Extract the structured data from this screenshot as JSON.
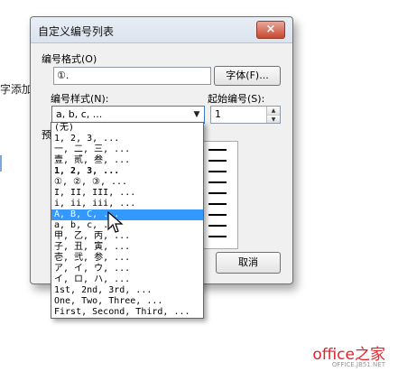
{
  "background": {
    "text": "字添加"
  },
  "dialog": {
    "title": "自定义编号列表",
    "close_glyph": "×",
    "format_label": "编号格式(O)",
    "format_value": "①.",
    "font_button": "字体(F)...",
    "style_label": "编号样式(N):",
    "style_value": "a, b, c, ...",
    "start_label": "起始编号(S):",
    "start_value": "1",
    "preview_label": "预",
    "cancel_button": "取消"
  },
  "dropdown": {
    "selected_index": 8,
    "options": [
      "(无)",
      "1, 2, 3, ...",
      "一, 二, 三, ...",
      "壹, 贰, 叁, ...",
      "1, 2, 3, ...",
      "①, ②, ③, ...",
      "I, II, III, ...",
      "i, ii, iii, ...",
      "A, B, C, ...",
      "a, b, c, ...",
      "甲, 乙, 丙, ...",
      "子, 丑, 寅, ...",
      "壱, 弐, 参, ...",
      "ア, イ, ウ, ...",
      "イ, ロ, ハ, ...",
      "1st, 2nd, 3rd, ...",
      "One, Two, Three, ...",
      "First, Second, Third, ..."
    ]
  },
  "watermark": {
    "logo": "office之家",
    "url": "OFFICE.JB51.NET"
  },
  "colors": {
    "selection": "#3399ff",
    "watermark": "#e0242a"
  }
}
